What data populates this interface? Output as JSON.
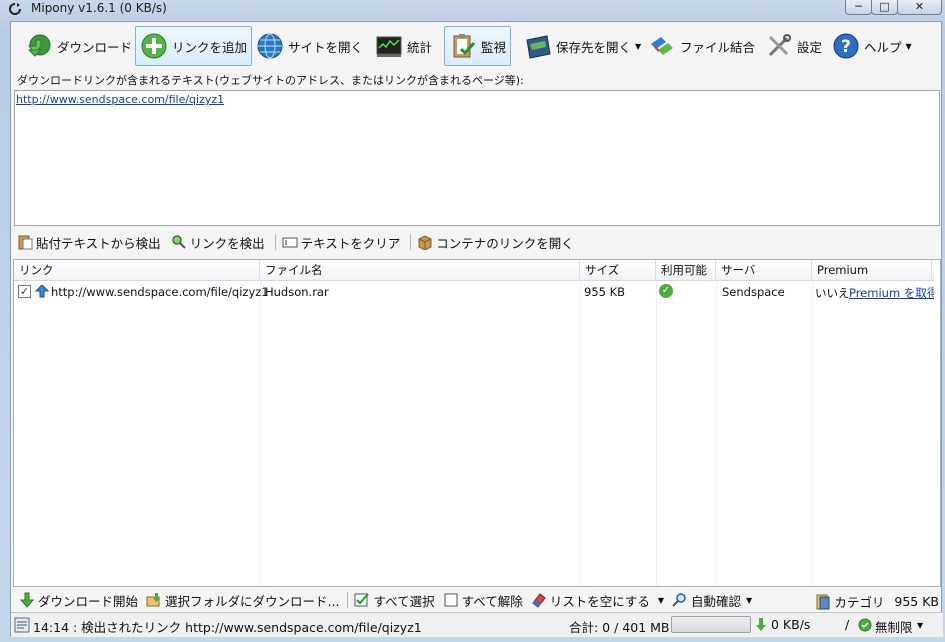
{
  "window": {
    "title": "Mipony v1.6.1 (0 KB/s)",
    "controls": {
      "minimize": "─",
      "maximize": "□",
      "close": "✕"
    }
  },
  "toolbar": {
    "download": "ダウンロード",
    "add_link": "リンクを追加",
    "open_site": "サイトを開く",
    "stats": "統計",
    "monitor": "監視",
    "open_dest": "保存先を開く",
    "join_files": "ファイル結合",
    "settings": "設定",
    "help": "ヘルプ",
    "dropdown_arrow": "▼"
  },
  "url_area": {
    "hint": "ダウンロードリンクが含まれるテキスト(ウェブサイトのアドレス、またはリンクが含まれるページ等):",
    "text": "http://www.sendspace.com/file/qizyz1"
  },
  "mid_toolbar": {
    "detect_from_paste": "貼付テキストから検出",
    "detect_links": "リンクを検出",
    "clear_text": "テキストをクリア",
    "open_container": "コンテナのリンクを開く"
  },
  "table": {
    "columns": [
      "リンク",
      "ファイル名",
      "サイズ",
      "利用可能",
      "サーバ",
      "Premium"
    ],
    "rows": [
      {
        "checked": "✓",
        "link": "http://www.sendspace.com/file/qizyz1",
        "filename": "Hudson.rar",
        "size": "955 KB",
        "available": "✓",
        "server": "Sendspace",
        "premium_no": "いいえ",
        "premium_link": "Premium を取得"
      }
    ]
  },
  "bottom_toolbar": {
    "start_download": "ダウンロード開始",
    "download_to_folder": "選択フォルダにダウンロード...",
    "select_all": "すべて選択",
    "deselect_all": "すべて解除",
    "empty_list": "リストを空にする",
    "auto_check": "自動確認",
    "category": "カテゴリ",
    "category_size": "955 KB"
  },
  "status": {
    "message": "14:14 : 検出されたリンク http://www.sendspace.com/file/qizyz1",
    "total": "合計: 0 / 401 MB",
    "progress": 0,
    "speed": "0 KB/s",
    "divider": "/",
    "limit": "無制限"
  },
  "colors": {
    "accent": "#1240a8",
    "window_bg": "#c9d8ea",
    "client_bg": "#f4f4f4"
  }
}
